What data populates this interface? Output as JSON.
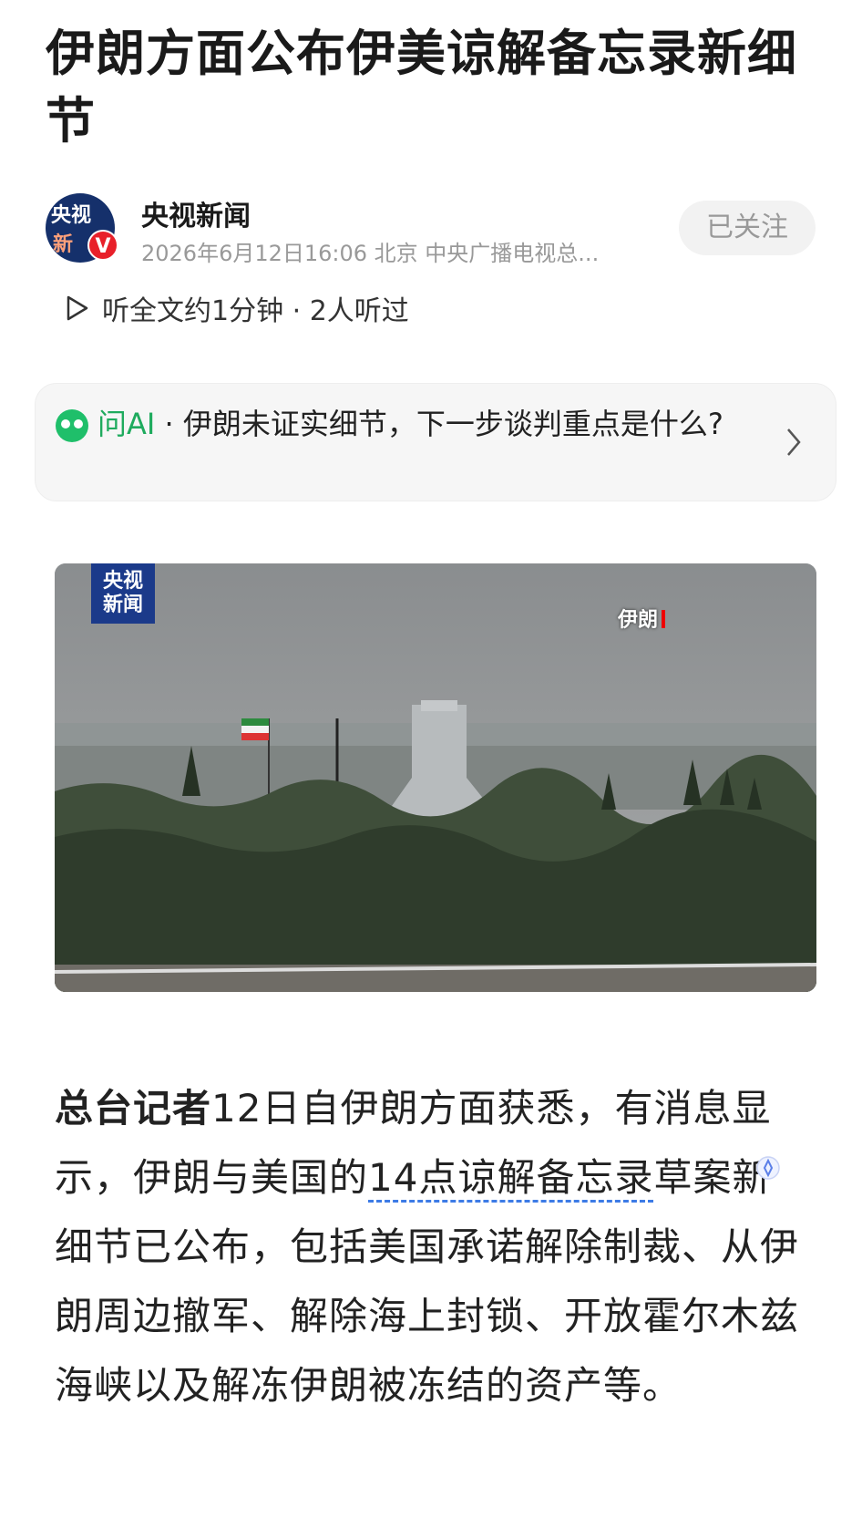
{
  "article": {
    "title": "伊朗方面公布伊美谅解备忘录新细节"
  },
  "author": {
    "avatar_top": "央视",
    "avatar_bottom": "新",
    "verified_badge": "V",
    "name": "央视新闻",
    "meta": "2026年6月12日16:06 北京 中央广播电视总...",
    "follow_label": "已关注"
  },
  "listen": {
    "label": "听全文约1分钟 · 2人听过"
  },
  "ai_prompt": {
    "label": "问AI",
    "separator": " · ",
    "question": "伊朗未证实细节，下一步谈判重点是什么?"
  },
  "photo": {
    "logo_line1": "央视",
    "logo_line2": "新闻",
    "location_tag": "伊朗"
  },
  "body": {
    "lead": "总台记者",
    "part1": "12日自伊朗方面获悉，有消息显示，伊朗与美国的",
    "link": "14点谅解备忘录",
    "part2": "草案新细节已公布，包括美国承诺解除制裁、从伊朗周边撤军、解除海上封锁、开放霍尔木兹海峡以及解冻伊朗被冻结的资产等。"
  },
  "colors": {
    "accent_green": "#1fab5e",
    "link_blue": "#3d7be6",
    "verified_red": "#e8202a",
    "cctv_blue": "#1b3a8a"
  },
  "icons": [
    "play-icon",
    "ai-assistant-icon",
    "chevron-right-icon",
    "ai-spark-icon",
    "verified-icon"
  ]
}
